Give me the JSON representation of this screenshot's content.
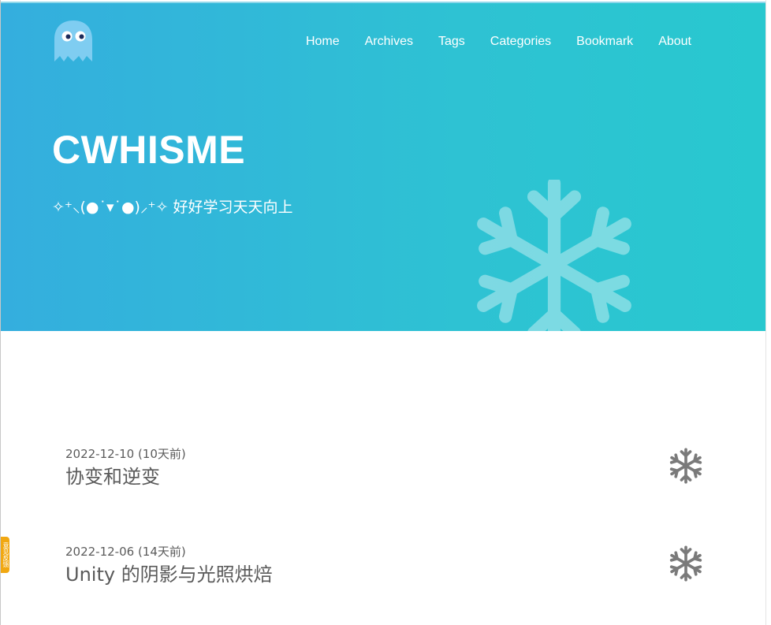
{
  "nav": {
    "items": [
      {
        "label": "Home"
      },
      {
        "label": "Archives"
      },
      {
        "label": "Tags"
      },
      {
        "label": "Categories"
      },
      {
        "label": "Bookmark"
      },
      {
        "label": "About"
      }
    ]
  },
  "hero": {
    "title": "CWHISME",
    "subtitle": "✧⁺⸜(●˙▾˙●)⸝⁺✧ 好好学习天天向上"
  },
  "posts": [
    {
      "date": "2022-12-10 (10天前)",
      "title": "协变和逆变",
      "icon": "snowflake-icon"
    },
    {
      "date": "2022-12-06 (14天前)",
      "title": "Unity 的阴影与光照烘焙",
      "icon": "snowflake-icon"
    }
  ],
  "feedback": {
    "label": "意见反馈"
  },
  "colors": {
    "hero_start": "#34aede",
    "hero_end": "#28c8cf",
    "text_muted": "#5a5a5a",
    "icon_gray": "#7a7a7a",
    "feedback": "#f1a812"
  }
}
